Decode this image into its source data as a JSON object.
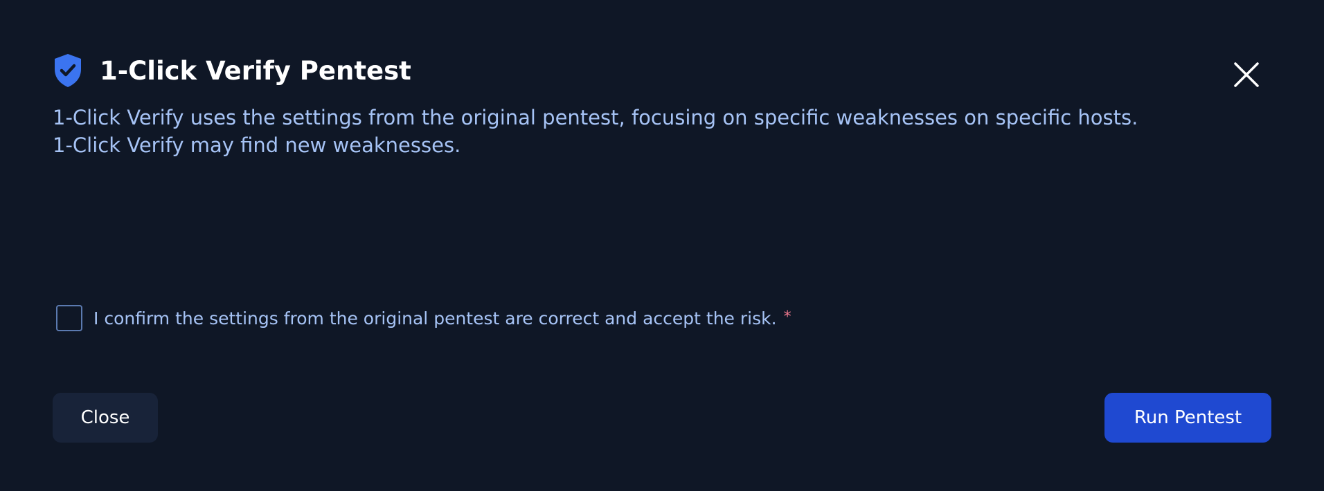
{
  "dialog": {
    "title": "1-Click Verify Pentest",
    "description_line1": "1-Click Verify uses the settings from the original pentest, focusing on specific weaknesses on specific hosts.",
    "description_line2": "1-Click Verify may find new weaknesses.",
    "confirm_label": "I confirm the settings from the original pentest are correct and accept the risk.",
    "required_marker": "*",
    "close_button_label": "Close",
    "run_button_label": "Run Pentest",
    "checkbox_checked": false,
    "icons": {
      "title_icon": "shield-check-icon",
      "dismiss_icon": "close-icon"
    },
    "colors": {
      "background": "#0f1726",
      "accent": "#1f49d1",
      "shield": "#3b74f0",
      "description_text": "#a6c3f5",
      "required": "#f27a8f"
    }
  }
}
